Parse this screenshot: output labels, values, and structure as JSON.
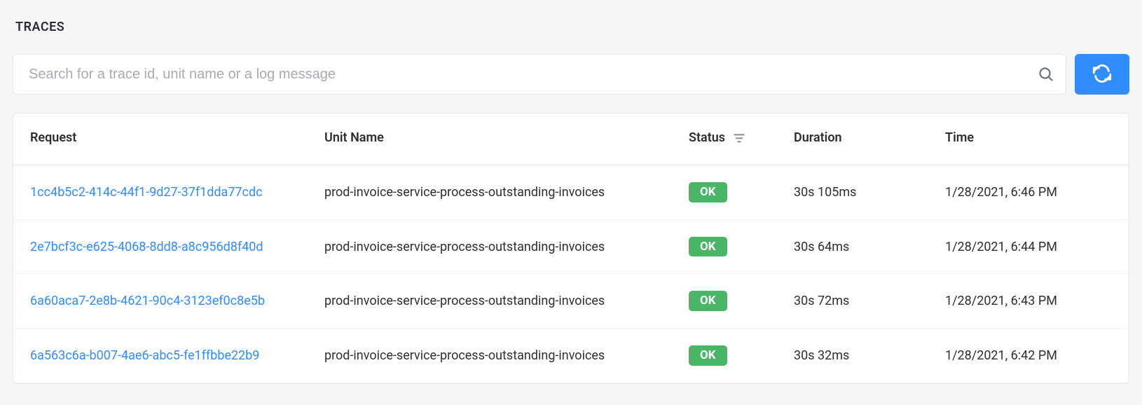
{
  "title": "TRACES",
  "search": {
    "placeholder": "Search for a trace id, unit name or a log message",
    "value": ""
  },
  "table": {
    "headers": {
      "request": "Request",
      "unit": "Unit Name",
      "status": "Status",
      "duration": "Duration",
      "time": "Time"
    },
    "rows": [
      {
        "request": "1cc4b5c2-414c-44f1-9d27-37f1dda77cdc",
        "unit": "prod-invoice-service-process-outstanding-invoices",
        "status": "OK",
        "duration": "30s 105ms",
        "time": "1/28/2021, 6:46 PM"
      },
      {
        "request": "2e7bcf3c-e625-4068-8dd8-a8c956d8f40d",
        "unit": "prod-invoice-service-process-outstanding-invoices",
        "status": "OK",
        "duration": "30s 64ms",
        "time": "1/28/2021, 6:44 PM"
      },
      {
        "request": "6a60aca7-2e8b-4621-90c4-3123ef0c8e5b",
        "unit": "prod-invoice-service-process-outstanding-invoices",
        "status": "OK",
        "duration": "30s 72ms",
        "time": "1/28/2021, 6:43 PM"
      },
      {
        "request": "6a563c6a-b007-4ae6-abc5-fe1ffbbe22b9",
        "unit": "prod-invoice-service-process-outstanding-invoices",
        "status": "OK",
        "duration": "30s 32ms",
        "time": "1/28/2021, 6:42 PM"
      }
    ]
  },
  "colors": {
    "link": "#2f8dff",
    "status_ok_bg": "#48b665",
    "primary_button": "#2f8dff"
  }
}
